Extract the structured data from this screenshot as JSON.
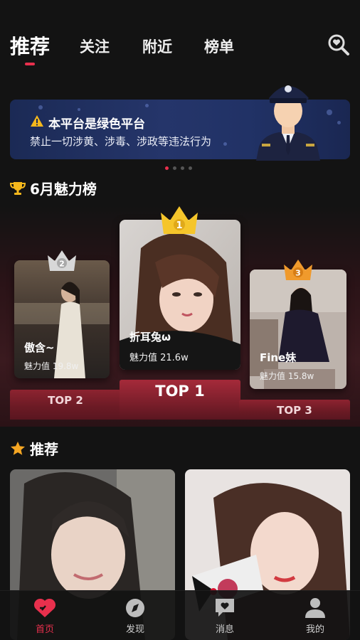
{
  "tabs": [
    {
      "label": "推荐",
      "active": true
    },
    {
      "label": "关注",
      "active": false
    },
    {
      "label": "附近",
      "active": false
    },
    {
      "label": "榜单",
      "active": false
    }
  ],
  "banner": {
    "title": "本平台是绿色平台",
    "subtitle": "禁止一切涉黄、涉毒、涉政等违法行为",
    "page_count": 4,
    "active_page": 1
  },
  "ranking": {
    "title": "6月魅力榜",
    "entries": [
      {
        "rank": "1",
        "name": "折耳兔ω",
        "score": "魅力值 21.6w",
        "podium": "TOP 1",
        "crown_color": "#f5c52b"
      },
      {
        "rank": "2",
        "name": "傲含~",
        "score": "魅力值 19.8w",
        "podium": "TOP 2",
        "crown_color": "#d8d8d8"
      },
      {
        "rank": "3",
        "name": "Fine妹",
        "score": "魅力值 15.8w",
        "podium": "TOP 3",
        "crown_color": "#f09a2c"
      }
    ]
  },
  "recommend": {
    "title": "推荐"
  },
  "nav": [
    {
      "label": "首页",
      "icon": "heart-chat-icon",
      "active": true
    },
    {
      "label": "发现",
      "icon": "compass-icon",
      "active": false
    },
    {
      "label": "消息",
      "icon": "message-heart-icon",
      "active": false
    },
    {
      "label": "我的",
      "icon": "person-icon",
      "active": false
    }
  ],
  "colors": {
    "accent": "#e8304d",
    "background": "#131313",
    "banner": "#1f2f62"
  }
}
